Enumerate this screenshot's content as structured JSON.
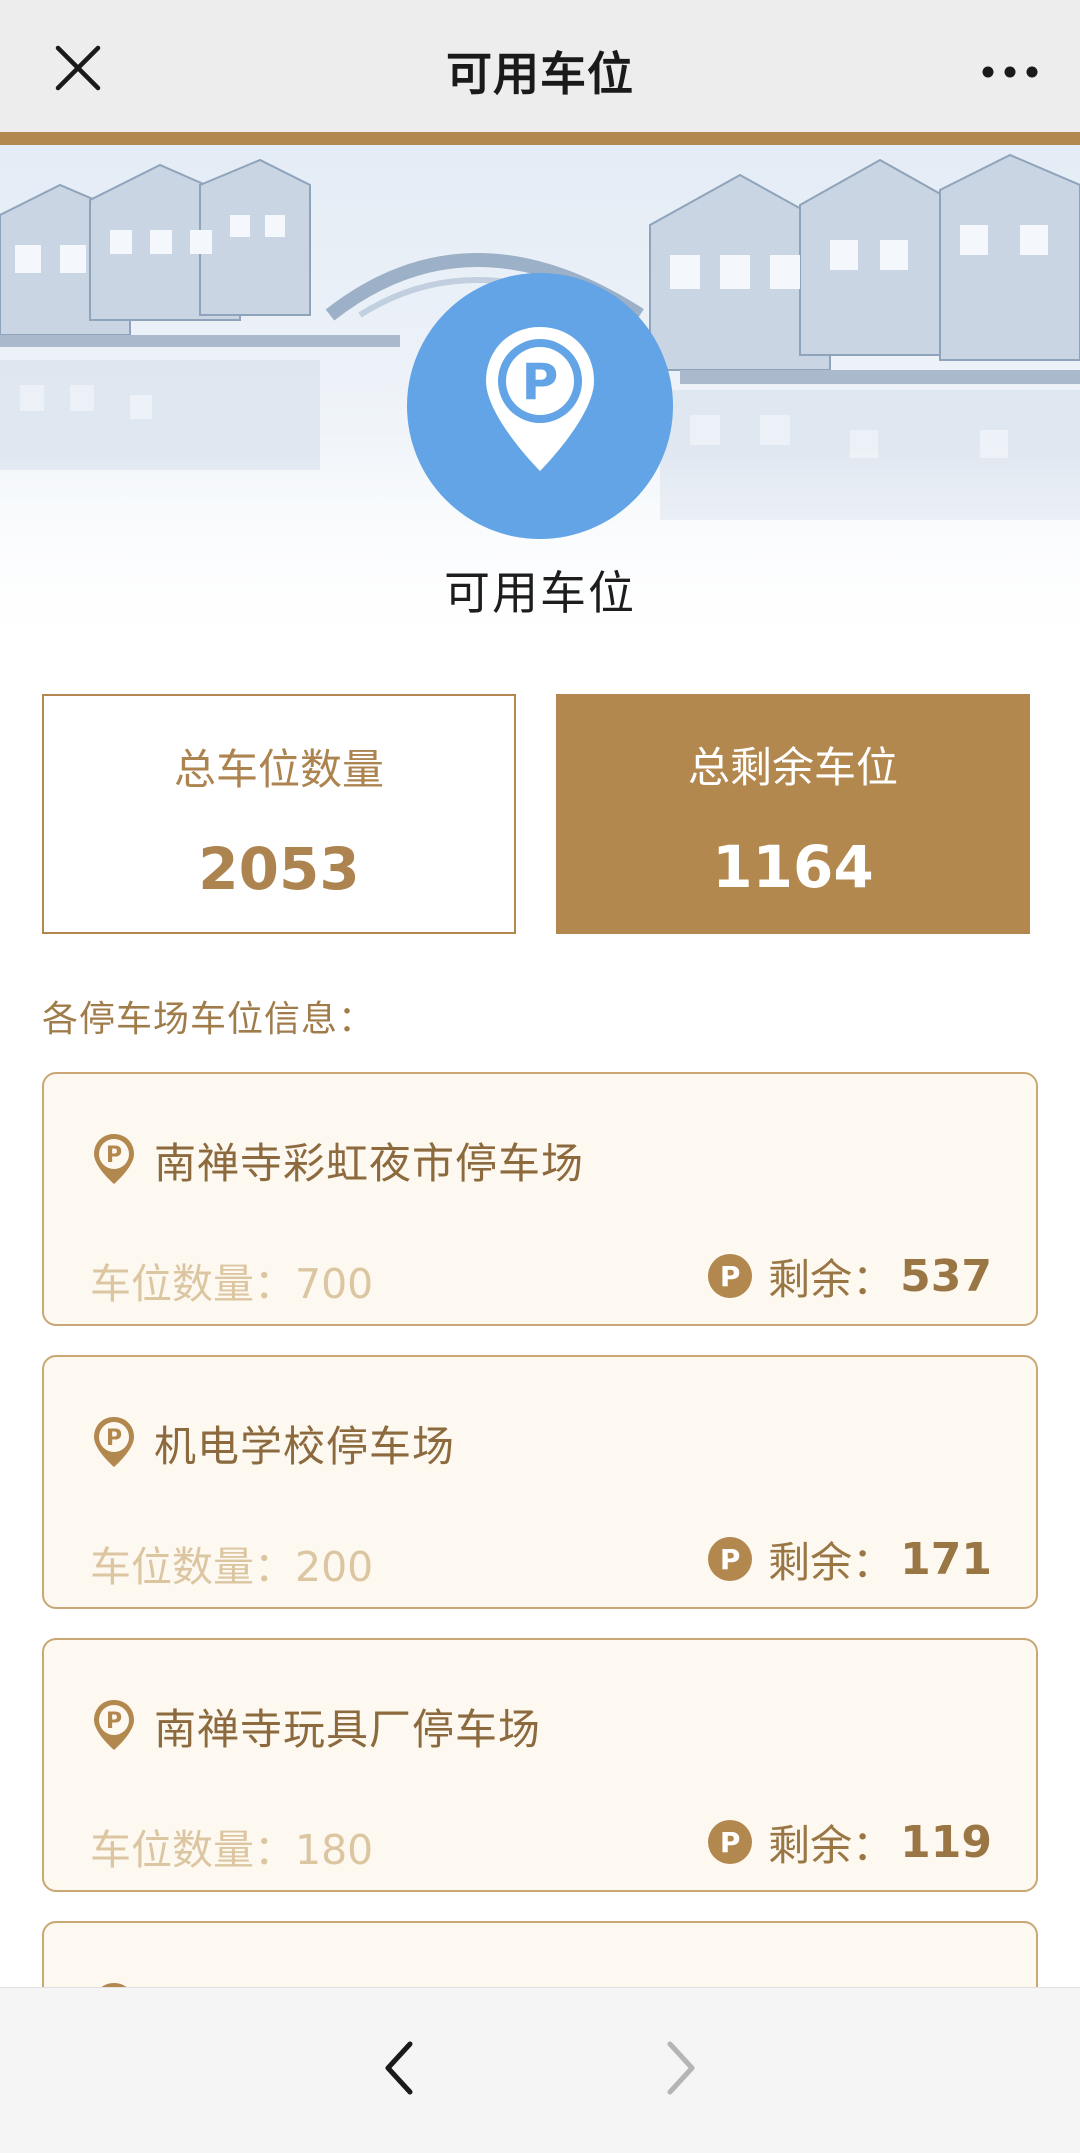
{
  "header": {
    "title": "可用车位"
  },
  "hero": {
    "label": "可用车位",
    "icon_letter": "P"
  },
  "stats": {
    "total_label": "总车位数量",
    "total_value": "2053",
    "remain_label": "总剩余车位",
    "remain_value": "1164"
  },
  "section_title": "各停车场车位信息：",
  "lots": [
    {
      "name": "南禅寺彩虹夜市停车场",
      "capacity_text": "车位数量：700",
      "remaining_label": "剩余：",
      "remaining_value": "537"
    },
    {
      "name": "机电学校停车场",
      "capacity_text": "车位数量：200",
      "remaining_label": "剩余：",
      "remaining_value": "171"
    },
    {
      "name": "南禅寺玩具厂停车场",
      "capacity_text": "车位数量：180",
      "remaining_label": "剩余：",
      "remaining_value": "119"
    }
  ],
  "colors": {
    "accent": "#b3884f",
    "hero_icon": "#62a4e6",
    "card_background": "#fdf9f1",
    "topbar": "#ededed"
  },
  "icons": [
    "close-icon",
    "more-icon",
    "parking-pin-icon",
    "parking-coin-icon",
    "back-arrow-icon",
    "forward-arrow-icon"
  ]
}
